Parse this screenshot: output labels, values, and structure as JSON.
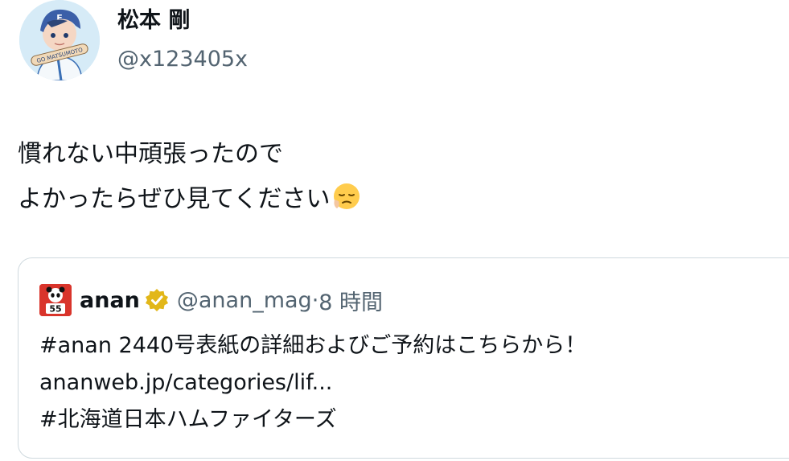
{
  "author": {
    "display_name": "松本 剛",
    "handle": "@x123405x",
    "avatar_badge": "GO MATSUMOTO"
  },
  "tweet": {
    "lines": [
      "慣れない中頑張ったので",
      "よかったらぜひ見てください"
    ],
    "emoji": "pensive-face"
  },
  "quote": {
    "display_name": "anan",
    "verified": true,
    "handle": "@anan_mag",
    "separator": "·",
    "time": "8 時間",
    "avatar_label": "55",
    "lines": [
      "#anan 2440号表紙の詳細およびご予約はこちらから！",
      "ananweb.jp/categories/lif...",
      "#北海道日本ハムファイターズ"
    ]
  },
  "colors": {
    "text": "#0f1419",
    "secondary": "#536471",
    "border": "#cfd9de",
    "verified_gold": "#e2b719",
    "anan_red": "#d9342b"
  }
}
